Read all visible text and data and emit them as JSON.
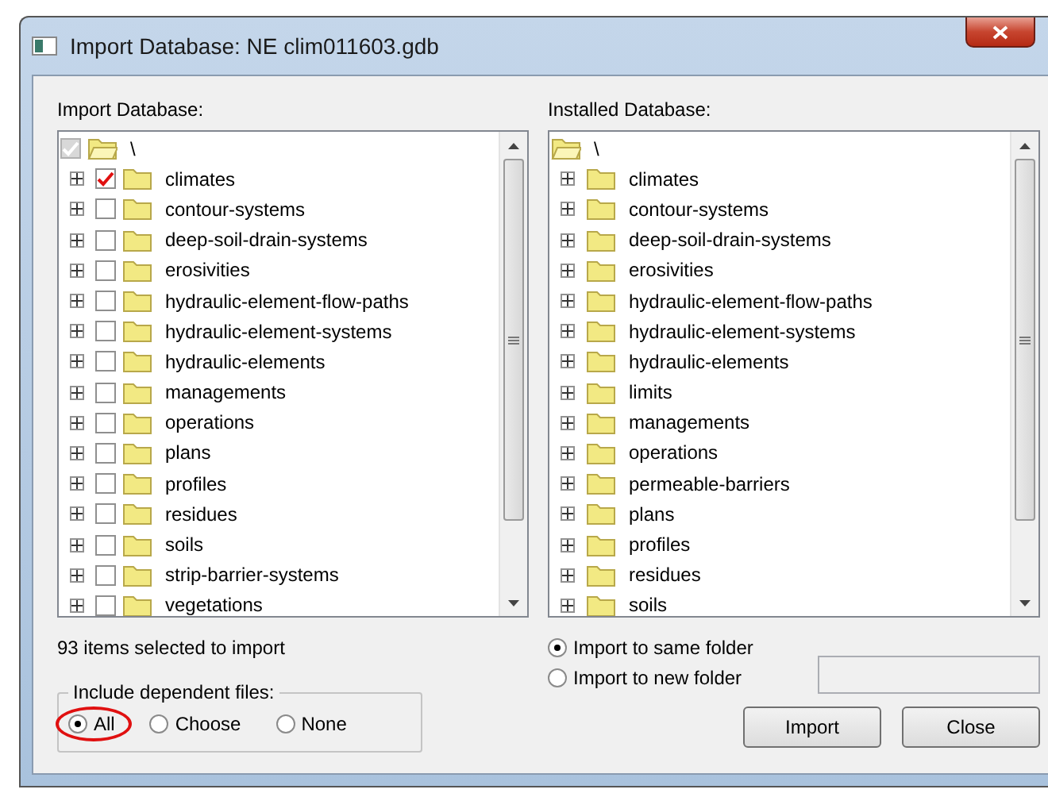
{
  "window": {
    "title": "Import Database: NE clim011603.gdb"
  },
  "import_tree": {
    "label": "Import Database:",
    "root": {
      "label": "\\",
      "checked": true,
      "expanded": true,
      "children": [
        {
          "label": "climates",
          "checked": true,
          "expanded": false
        },
        {
          "label": "contour-systems",
          "checked": false,
          "expanded": false
        },
        {
          "label": "deep-soil-drain-systems",
          "checked": false,
          "expanded": false
        },
        {
          "label": "erosivities",
          "checked": false,
          "expanded": false
        },
        {
          "label": "hydraulic-element-flow-paths",
          "checked": false,
          "expanded": false
        },
        {
          "label": "hydraulic-element-systems",
          "checked": false,
          "expanded": false
        },
        {
          "label": "hydraulic-elements",
          "checked": false,
          "expanded": false
        },
        {
          "label": "managements",
          "checked": false,
          "expanded": false
        },
        {
          "label": "operations",
          "checked": false,
          "expanded": false
        },
        {
          "label": "plans",
          "checked": false,
          "expanded": false
        },
        {
          "label": "profiles",
          "checked": false,
          "expanded": false
        },
        {
          "label": "residues",
          "checked": false,
          "expanded": false
        },
        {
          "label": "soils",
          "checked": false,
          "expanded": false
        },
        {
          "label": "strip-barrier-systems",
          "checked": false,
          "expanded": false
        },
        {
          "label": "vegetations",
          "checked": false,
          "expanded": false
        }
      ]
    }
  },
  "installed_tree": {
    "label": "Installed Database:",
    "root": {
      "label": "\\",
      "expanded": true,
      "children": [
        {
          "label": "climates",
          "expanded": false
        },
        {
          "label": "contour-systems",
          "expanded": false
        },
        {
          "label": "deep-soil-drain-systems",
          "expanded": false
        },
        {
          "label": "erosivities",
          "expanded": false
        },
        {
          "label": "hydraulic-element-flow-paths",
          "expanded": false
        },
        {
          "label": "hydraulic-element-systems",
          "expanded": false
        },
        {
          "label": "hydraulic-elements",
          "expanded": false
        },
        {
          "label": "limits",
          "expanded": false
        },
        {
          "label": "managements",
          "expanded": false
        },
        {
          "label": "operations",
          "expanded": false
        },
        {
          "label": "permeable-barriers",
          "expanded": false
        },
        {
          "label": "plans",
          "expanded": false
        },
        {
          "label": "profiles",
          "expanded": false
        },
        {
          "label": "residues",
          "expanded": false
        },
        {
          "label": "soils",
          "expanded": false
        }
      ]
    }
  },
  "selection_count": "93 items selected to import",
  "dependent_files": {
    "label": "Include dependent files:",
    "options": [
      {
        "label": "All",
        "selected": true,
        "highlighted": true
      },
      {
        "label": "Choose",
        "selected": false,
        "highlighted": false
      },
      {
        "label": "None",
        "selected": false,
        "highlighted": false
      }
    ]
  },
  "destination": {
    "options": [
      {
        "label": "Import to same folder",
        "selected": true
      },
      {
        "label": "Import to new folder",
        "selected": false
      }
    ]
  },
  "buttons": [
    "Import",
    "Close"
  ]
}
